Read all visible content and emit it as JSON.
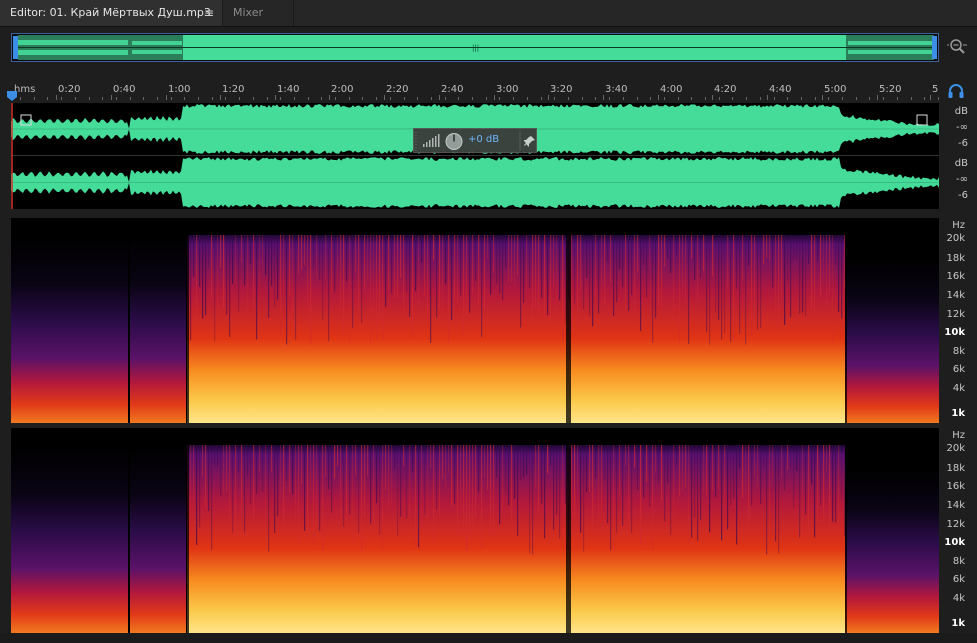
{
  "tabs": {
    "editor_label": "Editor: 01. Край Мёртвых Душ.mp3",
    "editor_menu_icon": "≡",
    "mixer_label": "Mixer"
  },
  "ruler": {
    "labels": [
      "hms",
      "0:20",
      "0:40",
      "1:00",
      "1:20",
      "1:40",
      "2:00",
      "2:20",
      "2:40",
      "3:00",
      "3:20",
      "3:40",
      "4:00",
      "4:20",
      "4:40",
      "5:00",
      "5:20",
      "5"
    ]
  },
  "waveform": {
    "color": "#45dc9a",
    "db_channel1": [
      "dB",
      "-∞",
      "-6"
    ],
    "db_channel2": [
      "dB",
      "-∞",
      "-6"
    ]
  },
  "hud": {
    "value": "+0 dB"
  },
  "spectrogram": {
    "hz_labels": [
      {
        "text": "Hz",
        "bold": false
      },
      {
        "text": "20k",
        "bold": false
      },
      {
        "text": "18k",
        "bold": false
      },
      {
        "text": "16k",
        "bold": false
      },
      {
        "text": "14k",
        "bold": false
      },
      {
        "text": "12k",
        "bold": false
      },
      {
        "text": "10k",
        "bold": true
      },
      {
        "text": "8k",
        "bold": false
      },
      {
        "text": "6k",
        "bold": false
      },
      {
        "text": "4k",
        "bold": false
      },
      {
        "text": "1k",
        "bold": true
      }
    ]
  },
  "colors": {
    "accent": "#3d8ee6",
    "wave": "#45dc9a"
  }
}
